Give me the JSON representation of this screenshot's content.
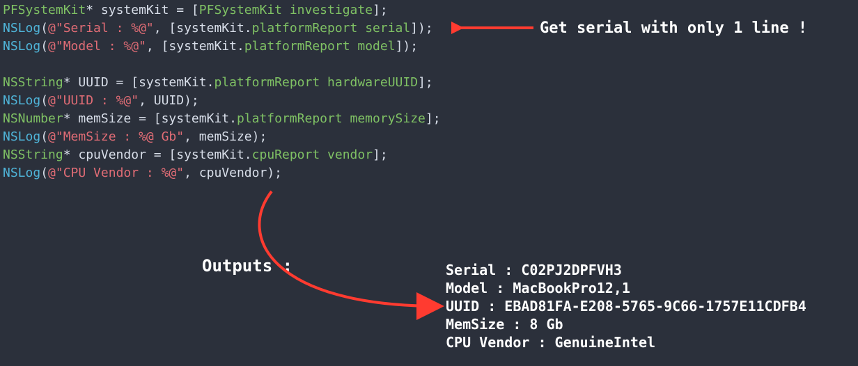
{
  "code": {
    "l1": {
      "a": "PFSystemKit",
      "b": "* systemKit = [",
      "c": "PFSystemKit",
      "d": " investigate",
      "e": "];"
    },
    "l2": {
      "a": "NSLog",
      "b": "(",
      "c": "@\"Serial : %@\"",
      "d": ", [systemKit.",
      "e": "platformReport",
      "f": " serial",
      "g": "]);"
    },
    "l3": {
      "a": "NSLog",
      "b": "(",
      "c": "@\"Model : %@\"",
      "d": ", [systemKit.",
      "e": "platformReport",
      "f": " model",
      "g": "]);"
    },
    "l5": {
      "a": "NSString",
      "b": "* UUID = [systemKit.",
      "c": "platformReport",
      "d": " hardwareUUID",
      "e": "];"
    },
    "l6": {
      "a": "NSLog",
      "b": "(",
      "c": "@\"UUID : %@\"",
      "d": ", UUID);"
    },
    "l7": {
      "a": "NSNumber",
      "b": "* memSize = [systemKit.",
      "c": "platformReport",
      "d": " memorySize",
      "e": "];"
    },
    "l8": {
      "a": "NSLog",
      "b": "(",
      "c": "@\"MemSize : %@ Gb\"",
      "d": ", memSize);"
    },
    "l9": {
      "a": "NSString",
      "b": "* cpuVendor = [systemKit.",
      "c": "cpuReport",
      "d": " vendor",
      "e": "];"
    },
    "l10": {
      "a": "NSLog",
      "b": "(",
      "c": "@\"CPU Vendor : %@\"",
      "d": ", cpuVendor);"
    }
  },
  "annotation1": "Get serial with only 1 line  !",
  "annotation2": "Outputs :",
  "output": {
    "serial": "Serial : C02PJ2DPFVH3",
    "model": "Model : MacBookPro12,1",
    "uuid": "UUID : EBAD81FA-E208-5765-9C66-1757E11CDFB4",
    "memsize": "MemSize : 8 Gb",
    "cpuvendor": "CPU Vendor : GenuineIntel"
  },
  "colors": {
    "arrow": "#ff3b30"
  }
}
